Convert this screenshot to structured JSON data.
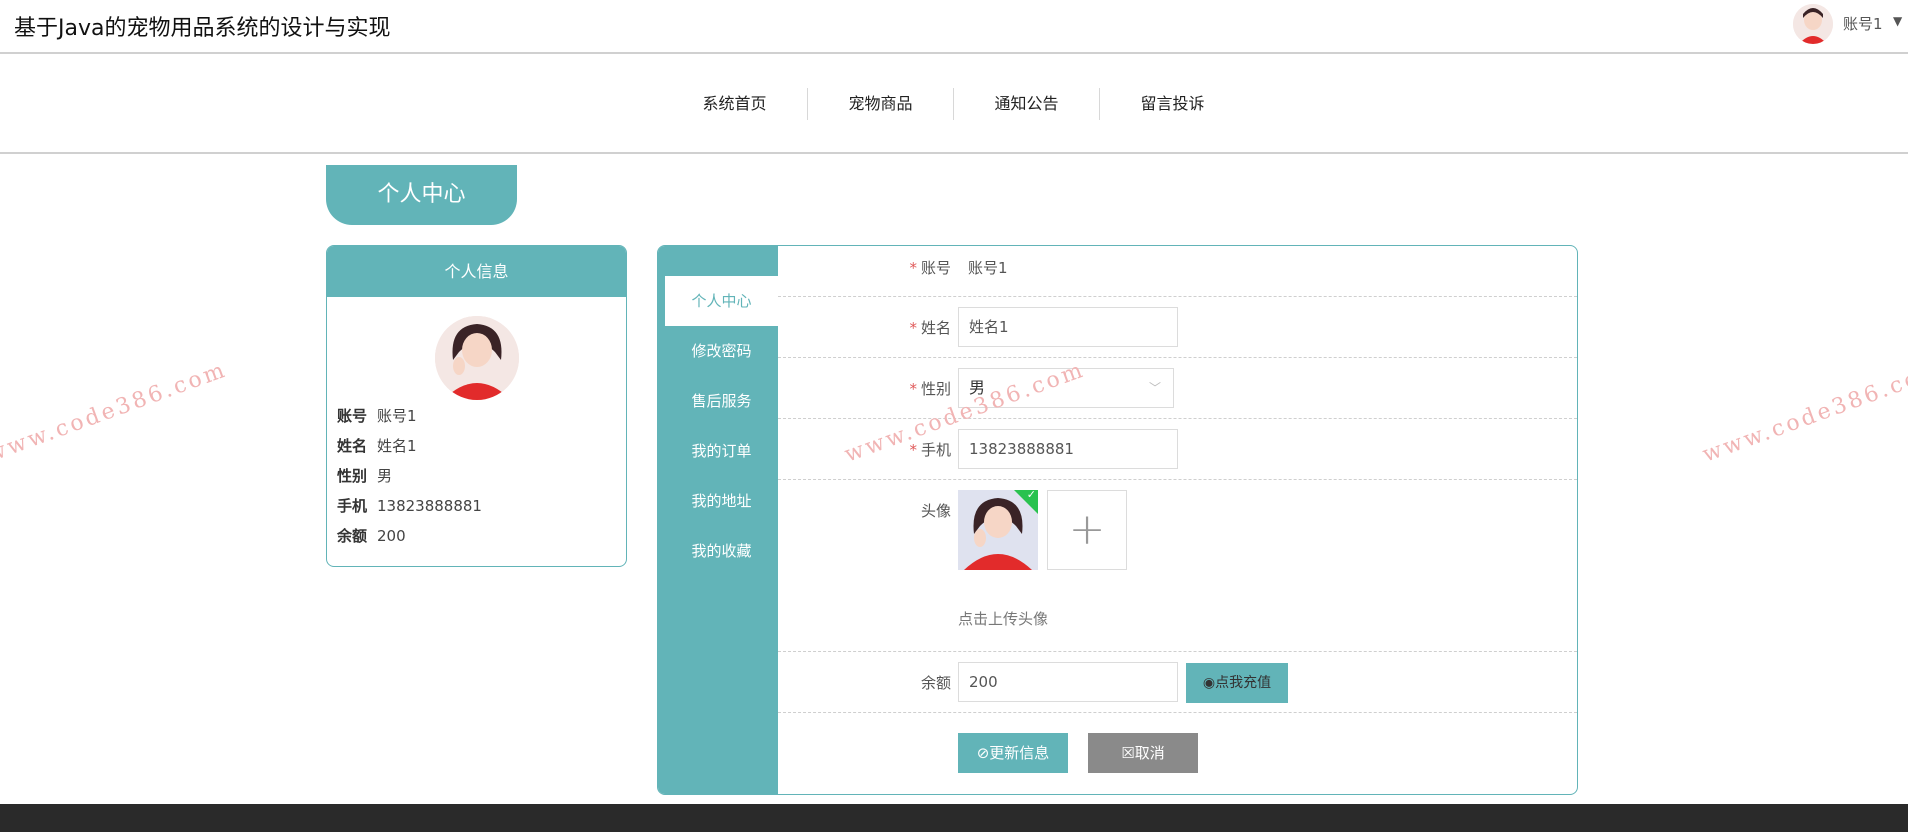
{
  "app": {
    "title": "基于Java的宠物用品系统的设计与实现"
  },
  "user": {
    "account": "账号1"
  },
  "nav": {
    "items": [
      "系统首页",
      "宠物商品",
      "通知公告",
      "留言投诉"
    ]
  },
  "page": {
    "title": "个人中心"
  },
  "info_card": {
    "title": "个人信息",
    "rows": [
      {
        "key": "账号",
        "value": "账号1"
      },
      {
        "key": "姓名",
        "value": "姓名1"
      },
      {
        "key": "性别",
        "value": "男"
      },
      {
        "key": "手机",
        "value": "13823888881"
      },
      {
        "key": "余额",
        "value": "200"
      }
    ]
  },
  "side_menu": {
    "items": [
      "个人中心",
      "修改密码",
      "售后服务",
      "我的订单",
      "我的地址",
      "我的收藏"
    ]
  },
  "form": {
    "account": {
      "label": "账号",
      "value": "账号1"
    },
    "name": {
      "label": "姓名",
      "value": "姓名1"
    },
    "gender": {
      "label": "性别",
      "value": "男"
    },
    "phone": {
      "label": "手机",
      "value": "13823888881"
    },
    "avatar": {
      "label": "头像",
      "hint": "点击上传头像"
    },
    "balance": {
      "label": "余额",
      "value": "200",
      "recharge_label": "点我充值"
    },
    "update_label": "更新信息",
    "cancel_label": "取消"
  },
  "watermark": "www.code386.com",
  "colors": {
    "accent": "#62b4b8",
    "footer": "#2a2a2a"
  }
}
